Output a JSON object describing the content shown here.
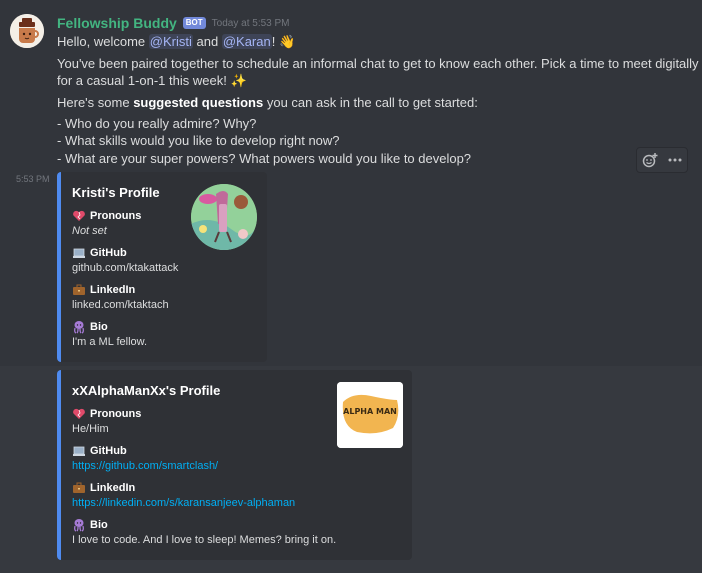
{
  "message": {
    "username": "Fellowship Buddy",
    "bot_tag": "BOT",
    "timestamp": "Today at 5:53 PM",
    "greeting": "Hello, welcome",
    "mention1": "@Kristi",
    "and": "and",
    "mention2": "@Karan",
    "greeting_end": "!",
    "wave_emoji": "👋",
    "line2": "You've been paired together to schedule an informal chat to get to know each other. Pick a time to meet digitally",
    "line3": "for a casual 1-on-1 this week!",
    "sparkles_emoji": "✨",
    "line4_pre": "Here's some",
    "line4_bold": "suggested questions",
    "line4_post": "you can ask in the call to get started:",
    "questions": [
      "- Who do you really admire? Why?",
      "- What skills would you like to develop right now?",
      "- What are your super powers? What powers would you like to develop?"
    ],
    "side_time": "5:53 PM"
  },
  "actions": {
    "react_icon": "add-reaction-icon",
    "more_icon": "more-icon"
  },
  "embeds": [
    {
      "title": "Kristi's Profile",
      "accent": "#4f8bf0",
      "fields": [
        {
          "name": "Pronouns",
          "value": "Not set",
          "icon": "heart-icon"
        },
        {
          "name": "GitHub",
          "value": "github.com/ktakattack",
          "icon": "laptop-icon"
        },
        {
          "name": "LinkedIn",
          "value": "linked.com/ktaktach",
          "icon": "briefcase-icon"
        },
        {
          "name": "Bio",
          "value": "I'm a ML fellow.",
          "icon": "octopus-icon"
        }
      ]
    },
    {
      "title": "xXAlphaManXx's Profile",
      "accent": "#4f8bf0",
      "thumb_text": "ALPHA MAN",
      "fields": [
        {
          "name": "Pronouns",
          "value": "He/Him",
          "icon": "heart-icon"
        },
        {
          "name": "GitHub",
          "value": "https://github.com/smartclash/",
          "icon": "laptop-icon"
        },
        {
          "name": "LinkedIn",
          "value": "https://linkedin.com/s/karansanjeev-alphaman",
          "icon": "briefcase-icon"
        },
        {
          "name": "Bio",
          "value": "I love to code. And I love to sleep! Memes? bring it on.",
          "icon": "octopus-icon"
        }
      ]
    }
  ],
  "colors": {
    "background": "#36393f",
    "username": "#43b581",
    "link": "#00aff4",
    "mention": "#a5b5f5",
    "embed_bg": "#2f3136"
  }
}
